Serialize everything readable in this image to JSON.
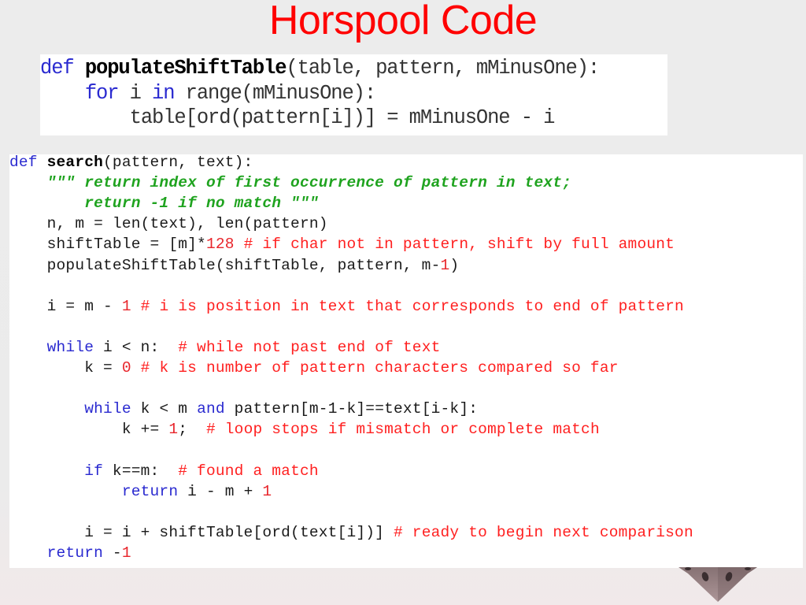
{
  "slide": {
    "title": "Horspool Code",
    "colors": {
      "title": "#ff0000",
      "keyword": "#2a2ad0",
      "docstring": "#1fa31f",
      "comment": "#ff2020",
      "number": "#e8252b",
      "plain": "#1a1a1a",
      "background": "#ebebeb",
      "code_panel": "#ffffff"
    }
  },
  "code_block_1": {
    "language": "python",
    "lines": [
      [
        {
          "t": "kw",
          "v": "def "
        },
        {
          "t": "fn",
          "v": "populateShiftTable"
        },
        {
          "t": "plain",
          "v": "(table, pattern, mMinusOne):"
        }
      ],
      [
        {
          "t": "plain",
          "v": "    "
        },
        {
          "t": "kw",
          "v": "for"
        },
        {
          "t": "plain",
          "v": " i "
        },
        {
          "t": "kw",
          "v": "in"
        },
        {
          "t": "plain",
          "v": " range(mMinusOne):"
        }
      ],
      [
        {
          "t": "plain",
          "v": "        table[ord(pattern[i])] = mMinusOne - i"
        }
      ]
    ]
  },
  "code_block_2": {
    "language": "python",
    "lines": [
      [
        {
          "t": "kw",
          "v": "def "
        },
        {
          "t": "fn",
          "v": "search"
        },
        {
          "t": "plain",
          "v": "(pattern, text):"
        }
      ],
      [
        {
          "t": "plain",
          "v": "    "
        },
        {
          "t": "str",
          "v": "\"\"\" return index of first occurrence of pattern in text;"
        }
      ],
      [
        {
          "t": "plain",
          "v": "        "
        },
        {
          "t": "str",
          "v": "return -1 if no match \"\"\""
        }
      ],
      [
        {
          "t": "plain",
          "v": "    n, m = len(text), len(pattern)"
        }
      ],
      [
        {
          "t": "plain",
          "v": "    shiftTable = [m]*"
        },
        {
          "t": "num",
          "v": "128"
        },
        {
          "t": "com",
          "v": " # if char not in pattern, shift by full amount"
        }
      ],
      [
        {
          "t": "plain",
          "v": "    populateShiftTable(shiftTable, pattern, m-"
        },
        {
          "t": "num",
          "v": "1"
        },
        {
          "t": "plain",
          "v": ")"
        }
      ],
      [],
      [
        {
          "t": "plain",
          "v": "    i = m - "
        },
        {
          "t": "num",
          "v": "1"
        },
        {
          "t": "com",
          "v": " # i is position in text that corresponds to end of pattern"
        }
      ],
      [],
      [
        {
          "t": "plain",
          "v": "    "
        },
        {
          "t": "kw",
          "v": "while"
        },
        {
          "t": "plain",
          "v": " i < n:  "
        },
        {
          "t": "com",
          "v": "# while not past end of text"
        }
      ],
      [
        {
          "t": "plain",
          "v": "        k = "
        },
        {
          "t": "num",
          "v": "0"
        },
        {
          "t": "com",
          "v": " # k is number of pattern characters compared so far"
        }
      ],
      [],
      [
        {
          "t": "plain",
          "v": "        "
        },
        {
          "t": "kw",
          "v": "while"
        },
        {
          "t": "plain",
          "v": " k < m "
        },
        {
          "t": "kw",
          "v": "and"
        },
        {
          "t": "plain",
          "v": " pattern[m-1-k]==text[i-k]:"
        }
      ],
      [
        {
          "t": "plain",
          "v": "            k += "
        },
        {
          "t": "num",
          "v": "1"
        },
        {
          "t": "plain",
          "v": ";  "
        },
        {
          "t": "com",
          "v": "# loop stops if mismatch or complete match"
        }
      ],
      [],
      [
        {
          "t": "plain",
          "v": "        "
        },
        {
          "t": "kw",
          "v": "if"
        },
        {
          "t": "plain",
          "v": " k==m:  "
        },
        {
          "t": "com",
          "v": "# found a match"
        }
      ],
      [
        {
          "t": "plain",
          "v": "            "
        },
        {
          "t": "kw",
          "v": "return"
        },
        {
          "t": "plain",
          "v": " i - m + "
        },
        {
          "t": "num",
          "v": "1"
        }
      ],
      [],
      [
        {
          "t": "plain",
          "v": "        i = i + shiftTable[ord(text[i])] "
        },
        {
          "t": "com",
          "v": "# ready to begin next comparison"
        }
      ],
      [
        {
          "t": "plain",
          "v": "    "
        },
        {
          "t": "kw",
          "v": "return"
        },
        {
          "t": "plain",
          "v": " -"
        },
        {
          "t": "num",
          "v": "1"
        }
      ]
    ]
  },
  "decoration": {
    "image": "dice-icon"
  }
}
